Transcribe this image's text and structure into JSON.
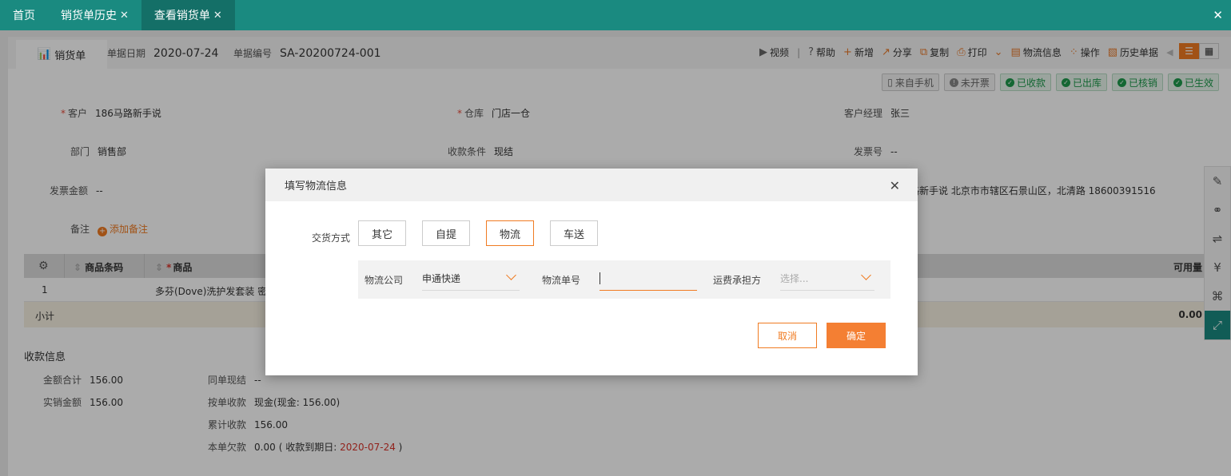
{
  "top_tabs": [
    {
      "label": "首页",
      "closable": false
    },
    {
      "label": "销货单历史",
      "closable": true
    },
    {
      "label": "查看销货单",
      "closable": true
    }
  ],
  "doc": {
    "tab_label": "销货单",
    "date_label": "单据日期",
    "date": "2020-07-24",
    "number_label": "单据编号",
    "number": "SA-20200724-001"
  },
  "toolbar": {
    "video": "视频",
    "help": "帮助",
    "add": "新增",
    "share": "分享",
    "copy": "复制",
    "print": "打印",
    "logistics": "物流信息",
    "operate": "操作",
    "history": "历史单据"
  },
  "tags": [
    "来自手机",
    "未开票",
    "已收款",
    "已出库",
    "已核销",
    "已生效"
  ],
  "form": {
    "customer_label": "客户",
    "customer": "186马路新手说",
    "warehouse_label": "仓库",
    "warehouse": "门店一仓",
    "manager_label": "客户经理",
    "manager": "张三",
    "dept_label": "部门",
    "dept": "销售部",
    "terms_label": "收款条件",
    "terms": "现结",
    "invoice_no_label": "发票号",
    "invoice_no": "--",
    "invoice_amt_label": "发票金额",
    "invoice_amt": "--",
    "address": "路新手说 北京市市辖区石景山区，北清路 18600391516",
    "note_label": "备注",
    "add_note": "添加备注"
  },
  "table": {
    "col_barcode": "商品条码",
    "col_product": "商品",
    "col_available": "可用量",
    "row_index": "1",
    "row_product": "多芬(Dove)洗护发套装 密",
    "subtotal_label": "小计",
    "subtotal_value": "0.00"
  },
  "summary": {
    "title": "收款信息",
    "total_label": "金额合计",
    "total": "156.00",
    "actual_label": "实销金额",
    "actual": "156.00",
    "same_cash_label": "同单现结",
    "same_cash": "--",
    "by_order_label": "按单收款",
    "by_order": "现金(现金: 156.00)",
    "accum_label": "累计收款",
    "accum": "156.00",
    "owed_label": "本单欠款",
    "owed": "0.00",
    "due_prefix": "( 收款到期日: ",
    "due_date": "2020-07-24",
    "due_suffix": " )"
  },
  "modal": {
    "title": "填写物流信息",
    "delivery_label": "交货方式",
    "options": [
      "其它",
      "自提",
      "物流",
      "车送"
    ],
    "selected_option": "物流",
    "company_label": "物流公司",
    "company_value": "申通快递",
    "tracking_label": "物流单号",
    "tracking_value": "",
    "payer_label": "运费承担方",
    "payer_placeholder": "选择...",
    "cancel": "取消",
    "confirm": "确定"
  },
  "icons": {
    "brand_orange": "#f07b22",
    "brand_teal": "#1a8a80",
    "ok_green": "#1f9a4c"
  }
}
